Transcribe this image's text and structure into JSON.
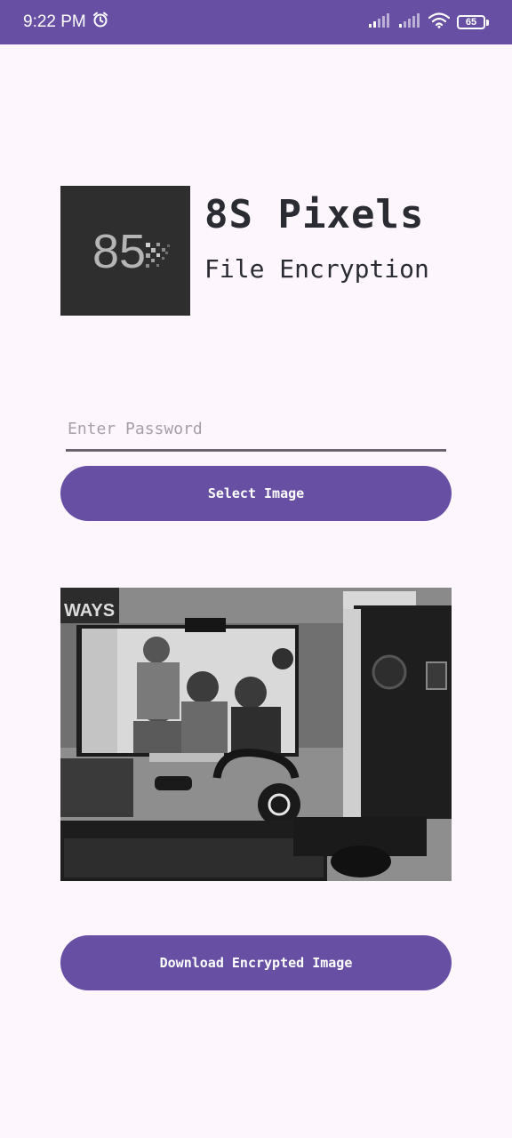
{
  "status": {
    "time": "9:22 PM",
    "battery": "65"
  },
  "header": {
    "logo_text": "85",
    "title": "8S Pixels",
    "subtitle": "File Encryption"
  },
  "form": {
    "password_placeholder": "Enter Password",
    "password_value": ""
  },
  "buttons": {
    "select_image": "Select Image",
    "download": "Download Encrypted Image"
  },
  "colors": {
    "primary": "#6750a4",
    "background": "#fdf7fd",
    "text": "#2b2b33"
  },
  "icons": [
    "alarm-icon",
    "signal-icon",
    "signal-icon",
    "wifi-icon",
    "battery-icon"
  ]
}
